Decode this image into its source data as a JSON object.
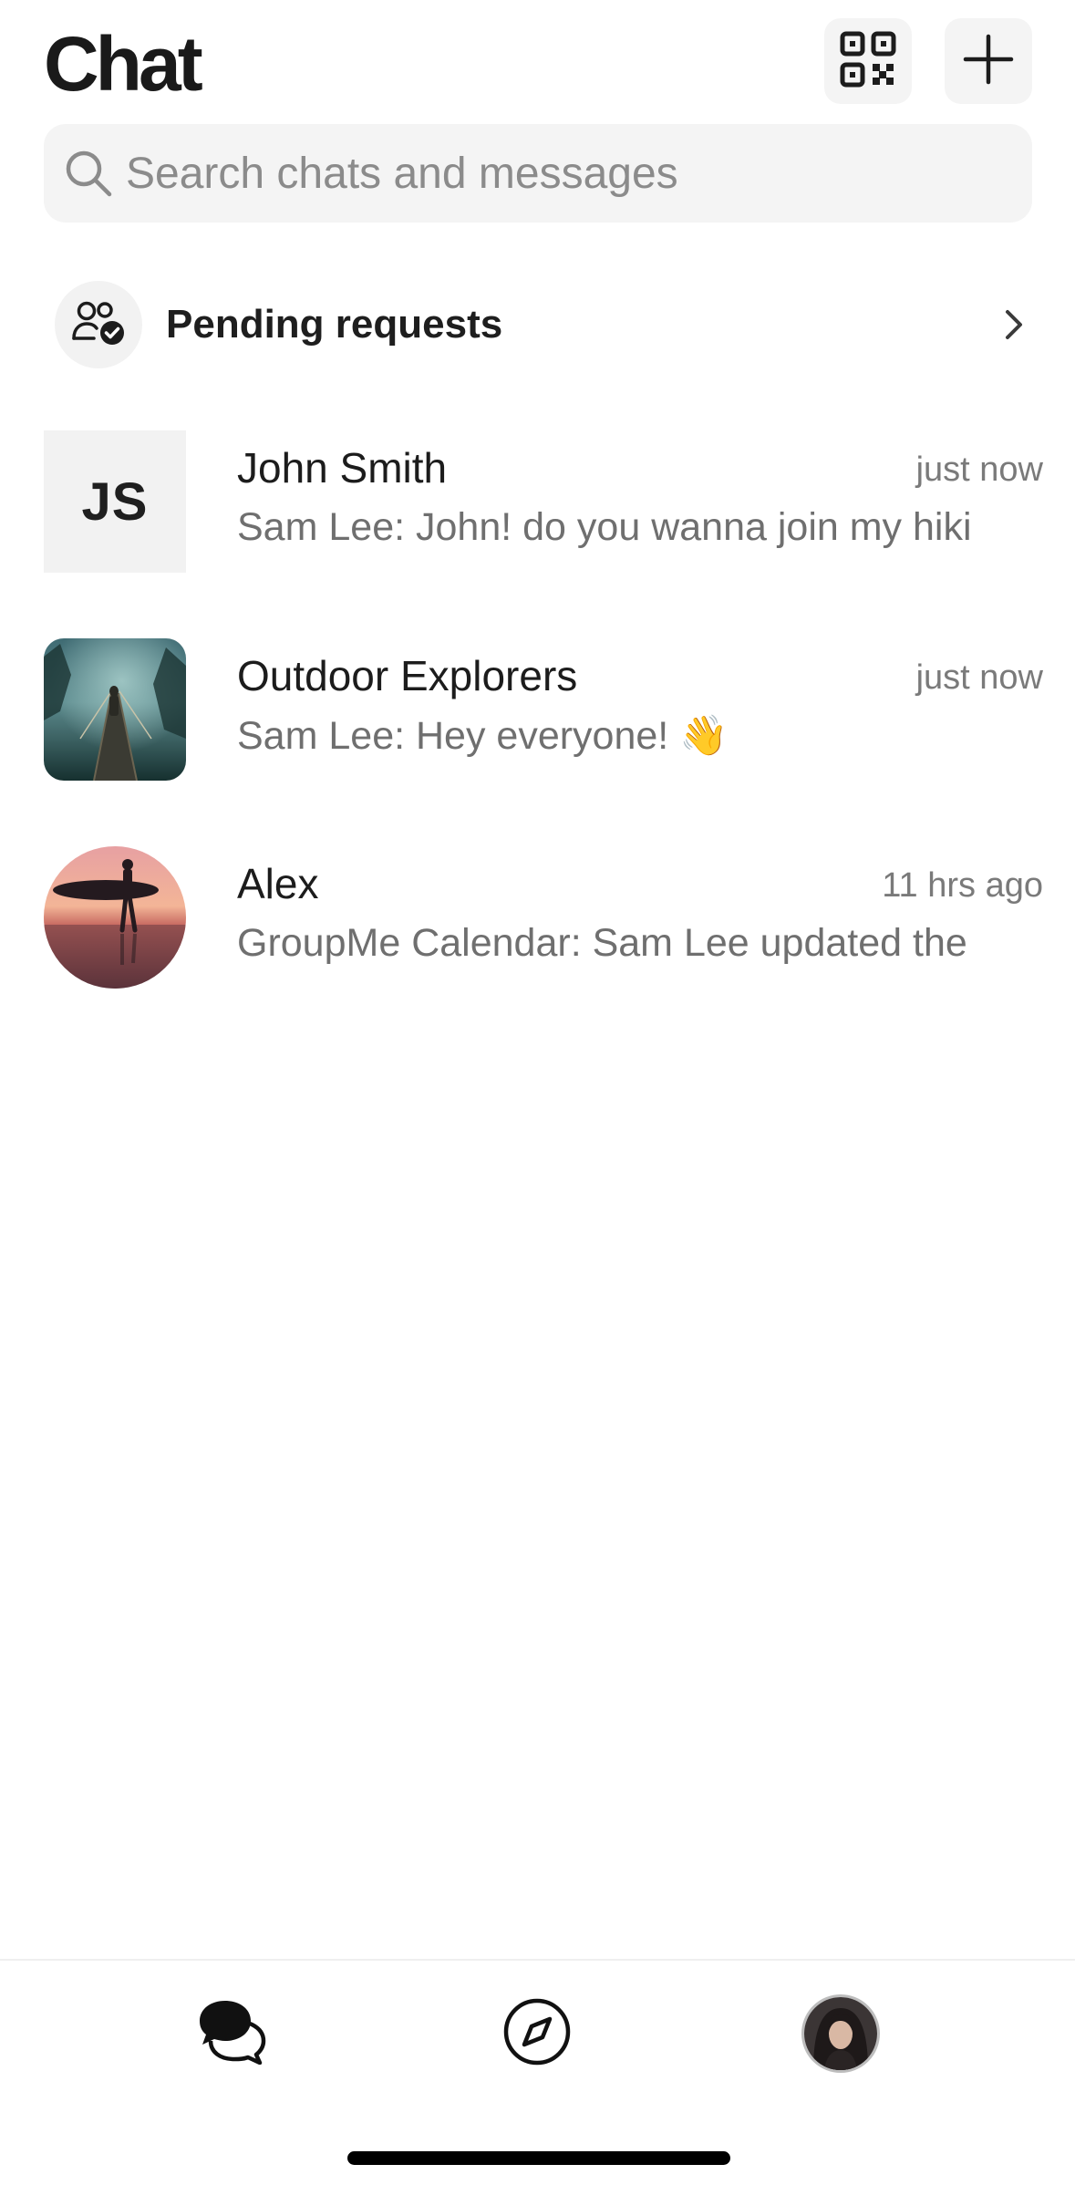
{
  "header": {
    "title": "Chat"
  },
  "search": {
    "placeholder": "Search chats and messages",
    "value": ""
  },
  "pending": {
    "label": "Pending requests"
  },
  "chats": [
    {
      "initials": "JS",
      "name": "John Smith",
      "time": "just now",
      "preview": "Sam Lee: John! do you wanna join my hiki"
    },
    {
      "name": "Outdoor Explorers",
      "time": "just now",
      "preview": "Sam Lee: Hey everyone! 👋"
    },
    {
      "name": "Alex",
      "time": "11 hrs ago",
      "preview": "GroupMe Calendar: Sam Lee updated the"
    }
  ],
  "icons": {
    "qr": "qr-code-icon",
    "new_chat": "plus-icon",
    "search": "search-icon",
    "pending": "user-check-icon",
    "chevron": "chevron-right-icon",
    "nav_chat": "chat-bubbles-icon",
    "nav_discover": "compass-icon",
    "nav_profile": "profile-avatar"
  },
  "colors": {
    "background": "#ffffff",
    "surface": "#f4f4f4",
    "text_primary": "#1a1a1a",
    "text_secondary": "#7a7a7a"
  }
}
